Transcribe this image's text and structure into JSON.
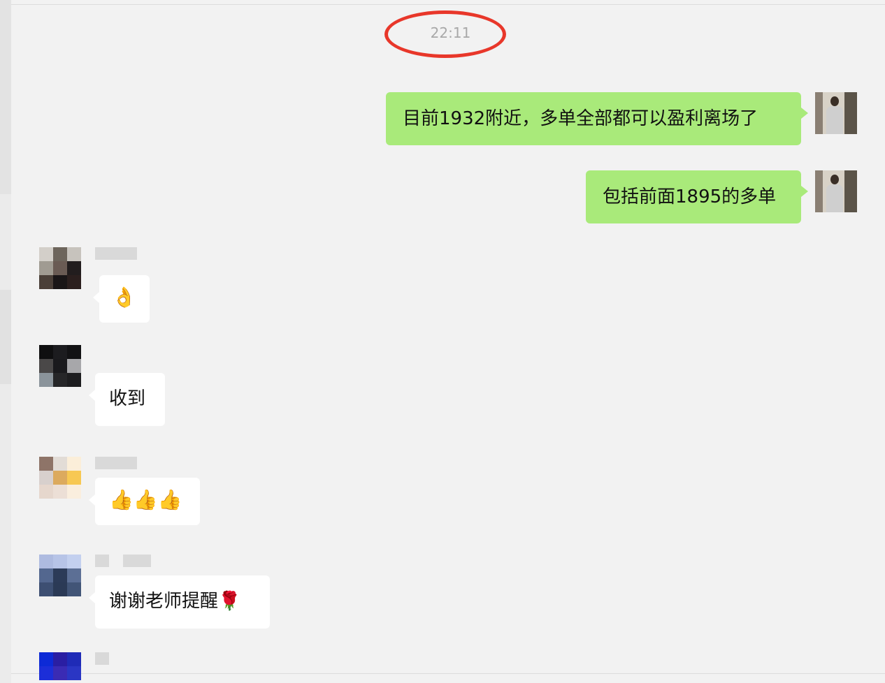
{
  "header": {
    "timestamp": "22:11"
  },
  "messages": [
    {
      "sender": "me",
      "text": "目前1932附近，多单全部都可以盈利离场了"
    },
    {
      "sender": "me",
      "text": "包括前面1895的多单"
    },
    {
      "sender": "other",
      "text": "👌"
    },
    {
      "sender": "other",
      "text": "收到"
    },
    {
      "sender": "other",
      "text": "👍👍👍"
    },
    {
      "sender": "other",
      "text": "谢谢老师提醒🌹"
    }
  ],
  "colors": {
    "background": "#f2f2f2",
    "outgoing_bubble": "#a9ea7a",
    "incoming_bubble": "#ffffff",
    "timestamp_highlight": "#e8372a"
  }
}
